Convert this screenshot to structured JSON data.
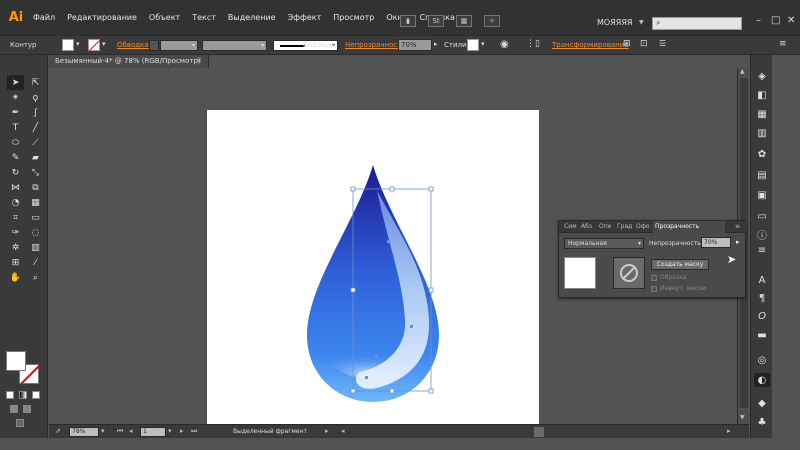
{
  "app": {
    "logo": "Ai"
  },
  "menu": [
    "Файл",
    "Редактирование",
    "Объект",
    "Текст",
    "Выделение",
    "Эффект",
    "Просмотр",
    "Окно",
    "Справка"
  ],
  "workspace": "МОЯЯЯЯ",
  "window_controls": [
    "–",
    "□",
    "✕"
  ],
  "control_bar": {
    "selection_label": "Контур",
    "stroke_label": "Обводка:",
    "stroke_style": "Базовый",
    "opacity_label": "Непрозрачность:",
    "opacity_value": "70%",
    "styles_label": "Стили:",
    "transform_label": "Трансформирование"
  },
  "document": {
    "tab_title": "Безымянный-4* @ 78% (RGB/Просмотр)",
    "close": "✕"
  },
  "transparency_panel": {
    "tabs": [
      "Сим",
      "Абз",
      "Опе",
      "Град",
      "Офо",
      "Прозрачность"
    ],
    "blend_mode": "Нормальная",
    "opacity_label": "Непрозрачность:",
    "opacity_value": "70%",
    "make_mask_button": "Создать маску",
    "clip_label": "Обрезка",
    "invert_mask_label": "Инверт. маски"
  },
  "status_bar": {
    "zoom": "78%",
    "artboard_number": "1",
    "selection_tool": "Выделенный фрагмент"
  },
  "colors": {
    "accent": "#f08a2a",
    "drop_dark": "#1a1e9a",
    "drop_light": "#5aa8f0",
    "selection": "#6f8fc9"
  }
}
